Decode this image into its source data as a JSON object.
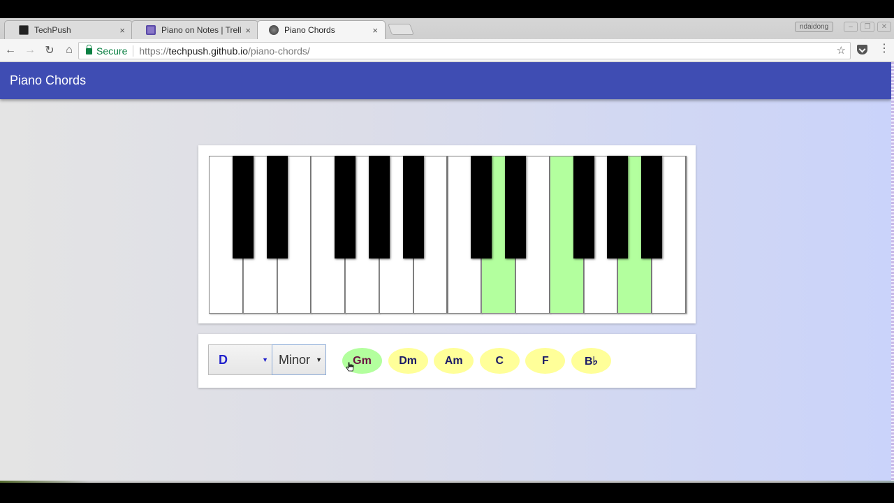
{
  "browser": {
    "tabs": [
      {
        "title": "TechPush",
        "icon": "techpush-favicon",
        "active": false
      },
      {
        "title": "Piano on Notes | Trello",
        "icon": "trello-favicon",
        "active": false
      },
      {
        "title": "Piano Chords",
        "icon": "piano-chords-favicon",
        "active": true
      }
    ],
    "close_glyph": "×",
    "profile_name": "ndaidong",
    "window_controls": {
      "minimize": "–",
      "restore": "❐",
      "close": "✕"
    },
    "nav": {
      "back": "←",
      "forward": "→",
      "reload": "↻",
      "home": "⌂"
    },
    "address": {
      "security_label": "Secure",
      "scheme": "https://",
      "host": "techpush.github.io",
      "path": "/piano-chords/"
    },
    "bookmark_star": "☆",
    "menu_glyph": "⋮"
  },
  "app": {
    "title": "Piano Chords",
    "accent_color": "#3f4db3",
    "highlight_color": "#b3ff9e",
    "chord_color": "#ffff99"
  },
  "piano": {
    "octaves": 2,
    "white_keys": [
      "C",
      "D",
      "E",
      "F",
      "G",
      "A",
      "B",
      "C",
      "D",
      "E",
      "F",
      "G",
      "A",
      "B"
    ],
    "black_keys": [
      "C#",
      "D#",
      "F#",
      "G#",
      "A#",
      "C#",
      "D#",
      "F#",
      "G#",
      "A#"
    ],
    "highlighted_notes": [
      "D2",
      "F2",
      "A2"
    ]
  },
  "controls": {
    "root_select": {
      "value": "D",
      "arrow": "▼"
    },
    "quality_select": {
      "value": "Minor",
      "arrow": "▼"
    },
    "chords": [
      {
        "label": "Gm",
        "active": true
      },
      {
        "label": "Dm",
        "active": false
      },
      {
        "label": "Am",
        "active": false
      },
      {
        "label": "C",
        "active": false
      },
      {
        "label": "F",
        "active": false
      },
      {
        "label": "B♭",
        "active": false
      }
    ]
  }
}
